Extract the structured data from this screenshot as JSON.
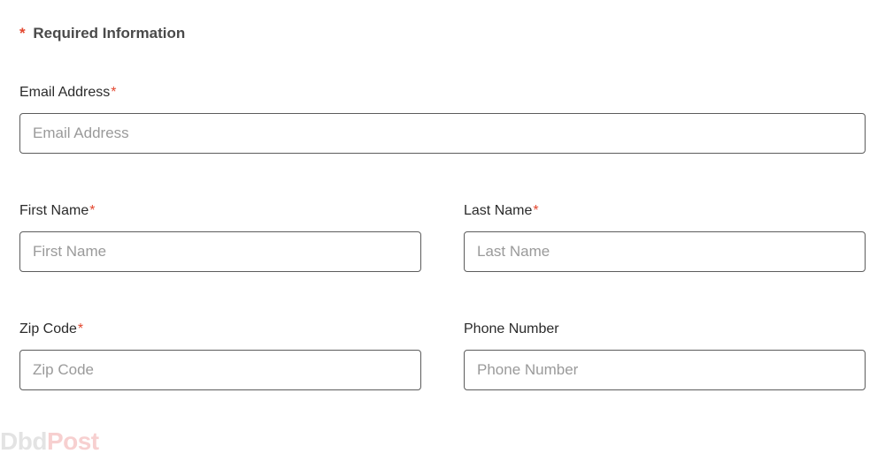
{
  "heading": {
    "asterisk": "*",
    "text": "Required Information"
  },
  "fields": {
    "email": {
      "label": "Email Address",
      "required_mark": "*",
      "placeholder": "Email Address"
    },
    "first_name": {
      "label": "First Name",
      "required_mark": "*",
      "placeholder": "First Name"
    },
    "last_name": {
      "label": "Last Name",
      "required_mark": "*",
      "placeholder": "Last Name"
    },
    "zip_code": {
      "label": "Zip Code",
      "required_mark": "*",
      "placeholder": "Zip Code"
    },
    "phone": {
      "label": "Phone Number",
      "placeholder": "Phone Number"
    }
  },
  "watermark": {
    "part1": "Dbd",
    "part2": "Post"
  }
}
